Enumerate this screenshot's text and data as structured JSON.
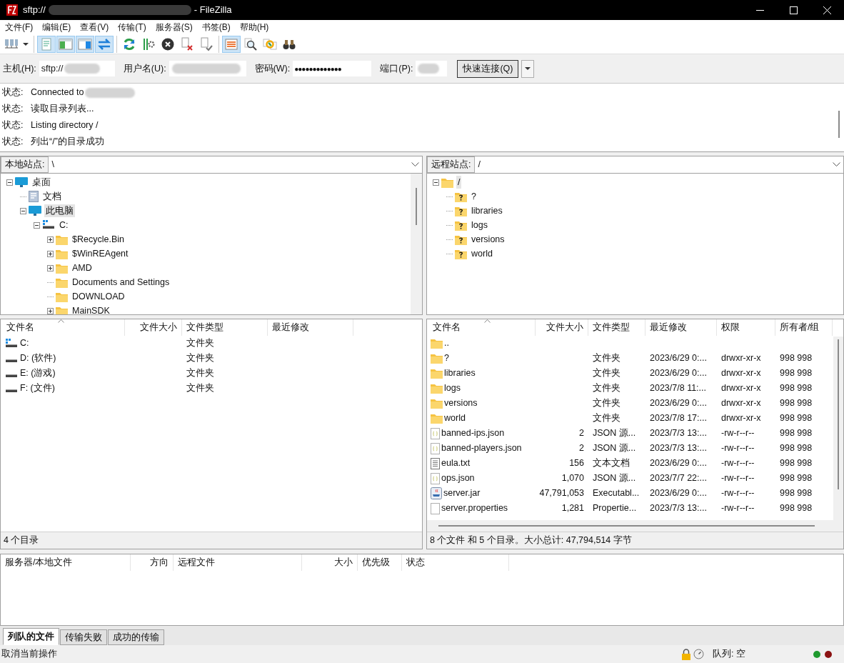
{
  "title_bar": {
    "title_prefix": "sftp://",
    "title_suffix": "- FileZilla"
  },
  "menu": [
    "文件(F)",
    "编辑(E)",
    "查看(V)",
    "传输(T)",
    "服务器(S)",
    "书签(B)",
    "帮助(H)"
  ],
  "toolbar": [
    [
      {
        "kind": "sitemanager",
        "pressed": false
      }
    ],
    [
      {
        "kind": "log",
        "pressed": true
      },
      {
        "kind": "localtree",
        "pressed": true
      },
      {
        "kind": "remotetree",
        "pressed": true
      },
      {
        "kind": "queue",
        "pressed": true
      }
    ],
    [
      {
        "kind": "refresh",
        "pressed": false
      },
      {
        "kind": "process",
        "pressed": false
      },
      {
        "kind": "cancel",
        "pressed": false
      },
      {
        "kind": "disconnect",
        "pressed": false
      },
      {
        "kind": "reconnect",
        "pressed": false
      }
    ],
    [
      {
        "kind": "filter",
        "pressed": true
      },
      {
        "kind": "search",
        "pressed": false
      },
      {
        "kind": "sync",
        "pressed": false
      },
      {
        "kind": "find",
        "pressed": false
      }
    ]
  ],
  "quickconnect": {
    "host": {
      "label": "主机(H):",
      "value": "sftp://"
    },
    "user": {
      "label": "用户名(U):"
    },
    "password": {
      "label": "密码(W):",
      "value": "●●●●●●●●●●●●●"
    },
    "port": {
      "label": "端口(P):"
    },
    "button": "快速连接(Q)"
  },
  "log": [
    {
      "label": "状态:",
      "text": "Connected to"
    },
    {
      "label": "状态:",
      "text": "读取目录列表..."
    },
    {
      "label": "状态:",
      "text": "Listing directory /"
    },
    {
      "label": "状态:",
      "text": "列出“/”的目录成功"
    }
  ],
  "local": {
    "site_label": "本地站点:",
    "path": "\\",
    "tree": [
      {
        "name": "桌面",
        "kind": "desktop",
        "expanded": true,
        "selected": false,
        "children": [
          {
            "name": "文档",
            "kind": "document",
            "selected": false
          },
          {
            "name": "此电脑",
            "kind": "computer",
            "expanded": true,
            "selected": true,
            "children": [
              {
                "name": "C:",
                "kind": "sysdrive",
                "expanded": true,
                "selected": false,
                "children": [
                  {
                    "name": "$Recycle.Bin",
                    "kind": "folder",
                    "expanded": false,
                    "selected": false
                  },
                  {
                    "name": "$WinREAgent",
                    "kind": "folder",
                    "expanded": false,
                    "selected": false
                  },
                  {
                    "name": "AMD",
                    "kind": "folder",
                    "expanded": false,
                    "selected": false
                  },
                  {
                    "name": "Documents and Settings",
                    "kind": "folder",
                    "selected": false
                  },
                  {
                    "name": "DOWNLOAD",
                    "kind": "folder",
                    "selected": false
                  },
                  {
                    "name": "MainSDK",
                    "kind": "folder",
                    "expanded": false,
                    "selected": false
                  }
                ]
              }
            ]
          }
        ]
      }
    ],
    "columns": [
      "文件名",
      "文件大小",
      "文件类型",
      "最近修改"
    ],
    "rows": [
      {
        "name": "C:",
        "kind": "sysdrive",
        "type": "文件夹"
      },
      {
        "name": "D: (软件)",
        "kind": "drive",
        "type": "文件夹"
      },
      {
        "name": "E: (游戏)",
        "kind": "drive",
        "type": "文件夹"
      },
      {
        "name": "F: (文件)",
        "kind": "drive",
        "type": "文件夹"
      }
    ],
    "status": "4 个目录"
  },
  "remote": {
    "site_label": "远程站点:",
    "path": "/",
    "tree": [
      {
        "name": "/",
        "kind": "folder",
        "expanded": true,
        "selected": true,
        "children": [
          {
            "name": "?",
            "kind": "unknown",
            "selected": false
          },
          {
            "name": "libraries",
            "kind": "unknown",
            "selected": false
          },
          {
            "name": "logs",
            "kind": "unknown",
            "selected": false
          },
          {
            "name": "versions",
            "kind": "unknown",
            "selected": false
          },
          {
            "name": "world",
            "kind": "unknown",
            "selected": false
          }
        ]
      }
    ],
    "columns": [
      "文件名",
      "文件大小",
      "文件类型",
      "最近修改",
      "权限",
      "所有者/组"
    ],
    "rows": [
      {
        "name": "..",
        "kind": "folder"
      },
      {
        "name": "?",
        "kind": "folder",
        "type": "文件夹",
        "modified": "2023/6/29 0:...",
        "perms": "drwxr-xr-x",
        "owner": "998 998"
      },
      {
        "name": "libraries",
        "kind": "folder",
        "type": "文件夹",
        "modified": "2023/6/29 0:...",
        "perms": "drwxr-xr-x",
        "owner": "998 998"
      },
      {
        "name": "logs",
        "kind": "folder",
        "type": "文件夹",
        "modified": "2023/7/8 11:...",
        "perms": "drwxr-xr-x",
        "owner": "998 998"
      },
      {
        "name": "versions",
        "kind": "folder",
        "type": "文件夹",
        "modified": "2023/6/29 0:...",
        "perms": "drwxr-xr-x",
        "owner": "998 998"
      },
      {
        "name": "world",
        "kind": "folder",
        "type": "文件夹",
        "modified": "2023/7/8 17:...",
        "perms": "drwxr-xr-x",
        "owner": "998 998"
      },
      {
        "name": "banned-ips.json",
        "kind": "json",
        "size": "2",
        "type": "JSON 源...",
        "modified": "2023/7/3 13:...",
        "perms": "-rw-r--r--",
        "owner": "998 998"
      },
      {
        "name": "banned-players.json",
        "kind": "json",
        "size": "2",
        "type": "JSON 源...",
        "modified": "2023/7/3 13:...",
        "perms": "-rw-r--r--",
        "owner": "998 998"
      },
      {
        "name": "eula.txt",
        "kind": "text",
        "size": "156",
        "type": "文本文档",
        "modified": "2023/6/29 0:...",
        "perms": "-rw-r--r--",
        "owner": "998 998"
      },
      {
        "name": "ops.json",
        "kind": "json",
        "size": "1,070",
        "type": "JSON 源...",
        "modified": "2023/7/7 22:...",
        "perms": "-rw-r--r--",
        "owner": "998 998"
      },
      {
        "name": "server.jar",
        "kind": "jar",
        "size": "47,791,053",
        "type": "Executabl...",
        "modified": "2023/6/29 0:...",
        "perms": "-rw-r--r--",
        "owner": "998 998"
      },
      {
        "name": "server.properties",
        "kind": "file",
        "size": "1,281",
        "type": "Propertie...",
        "modified": "2023/7/3 13:...",
        "perms": "-rw-r--r--",
        "owner": "998 998"
      }
    ],
    "status": "8 个文件 和 5 个目录。大小总计: 47,794,514 字节"
  },
  "queue": {
    "columns": [
      "服务器/本地文件",
      "方向",
      "远程文件",
      "大小",
      "优先级",
      "状态"
    ]
  },
  "tabs": [
    {
      "label": "列队的文件",
      "selected": true
    },
    {
      "label": "传输失败",
      "selected": false
    },
    {
      "label": "成功的传输",
      "selected": false
    }
  ],
  "status_bar": {
    "text": "取消当前操作",
    "queue": "队列: 空"
  }
}
